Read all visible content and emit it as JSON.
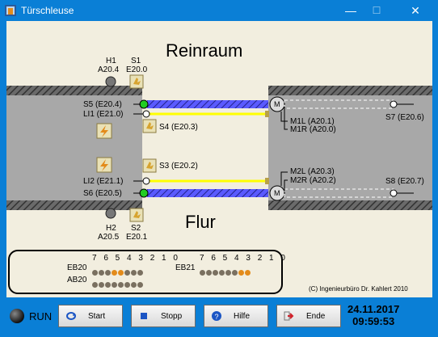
{
  "window": {
    "title": "Türschleuse",
    "minimize": "—",
    "maximize": "☐",
    "close": "✕"
  },
  "rooms": {
    "top": "Reinraum",
    "bottom": "Flur"
  },
  "top_labels": {
    "h1": "H1",
    "h1_addr": "A20.4",
    "s1": "S1",
    "s1_addr": "E20.0"
  },
  "bottom_labels": {
    "h2": "H2",
    "h2_addr": "A20.5",
    "s2": "S2",
    "s2_addr": "E20.1"
  },
  "left_labels": {
    "s5": "S5 (E20.4)",
    "li1": "LI1 (E21.0)",
    "li2": "LI2 (E21.1)",
    "s6": "S6 (E20.5)"
  },
  "mid_labels": {
    "s4": "S4 (E20.3)",
    "s3": "S3 (E20.2)"
  },
  "motor_labels": {
    "m1": "M",
    "m2": "M",
    "m1l": "M1L (A20.1)",
    "m1r": "M1R (A20.0)",
    "m2l": "M2L (A20.3)",
    "m2r": "M2R (A20.2)",
    "s7": "S7 (E20.6)",
    "s8": "S8 (E20.7)"
  },
  "io_panel": {
    "bits_header": "7 6 5 4 3 2 1 0",
    "eb20": {
      "label": "EB20",
      "bits": [
        0,
        0,
        0,
        1,
        1,
        0,
        0,
        0
      ]
    },
    "ab20": {
      "label": "AB20",
      "bits": [
        0,
        0,
        0,
        0,
        0,
        0,
        0,
        0
      ]
    },
    "eb21": {
      "label": "EB21",
      "bits": [
        0,
        0,
        0,
        0,
        0,
        0,
        1,
        1
      ]
    }
  },
  "copyright": "(C) Ingenieurbüro Dr. Kahlert 2010",
  "toolbar": {
    "run": "RUN",
    "start": "Start",
    "stopp": "Stopp",
    "hilfe": "Hilfe",
    "ende": "Ende"
  },
  "datetime": {
    "date": "24.11.2017",
    "time": "09:59:53"
  },
  "colors": {
    "title_bar": "#0a7fd6",
    "background": "#f2eedf",
    "wall": "#555555",
    "light_bar": "#ffff00",
    "door_track": "#4a4aff",
    "led_on": "#e38b1a",
    "led_green": "#22cc22"
  }
}
